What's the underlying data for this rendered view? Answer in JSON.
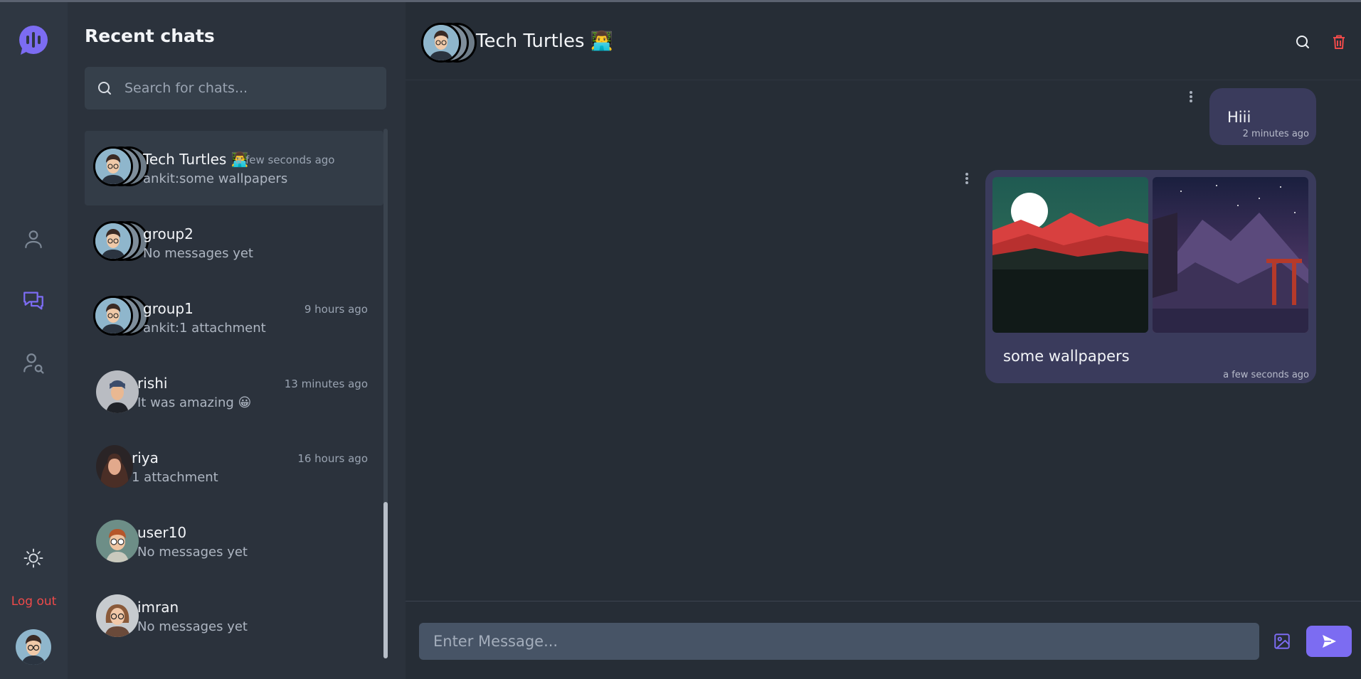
{
  "rail": {
    "logout_label": "Log out",
    "icons": [
      "logo-icon",
      "user-icon",
      "chats-icon",
      "user-search-icon",
      "sun-icon"
    ],
    "active_color": "#7c6cf2",
    "logout_color": "#ef4a4a"
  },
  "sidebar": {
    "title": "Recent chats",
    "search_placeholder": "Search for chats...",
    "chats": [
      {
        "name": "Tech Turtles 👨‍💻",
        "preview": "ankit:some wallpapers",
        "time": "a few seconds ago",
        "type": "group",
        "active": true
      },
      {
        "name": "group2",
        "preview": "No messages yet",
        "time": "",
        "type": "group"
      },
      {
        "name": "group1",
        "preview": "ankit:1 attachment",
        "time": "9 hours ago",
        "type": "group"
      },
      {
        "name": "rishi",
        "preview": "It was amazing 😀",
        "time": "13 minutes ago",
        "type": "user"
      },
      {
        "name": "riya",
        "preview": "1 attachment",
        "time": "16 hours ago",
        "type": "user"
      },
      {
        "name": "user10",
        "preview": "No messages yet",
        "time": "",
        "type": "user"
      },
      {
        "name": "imran",
        "preview": "No messages yet",
        "time": "",
        "type": "user"
      }
    ]
  },
  "chat": {
    "title": "Tech Turtles 👨‍💻",
    "messages": [
      {
        "text": "Hiii",
        "time": "2 minutes ago"
      },
      {
        "text": "some wallpapers",
        "time": "a few seconds ago",
        "attachments": 2
      }
    ],
    "input_placeholder": "Enter Message...",
    "accent": "#7c6cf2",
    "delete_color": "#ef4a4a"
  }
}
